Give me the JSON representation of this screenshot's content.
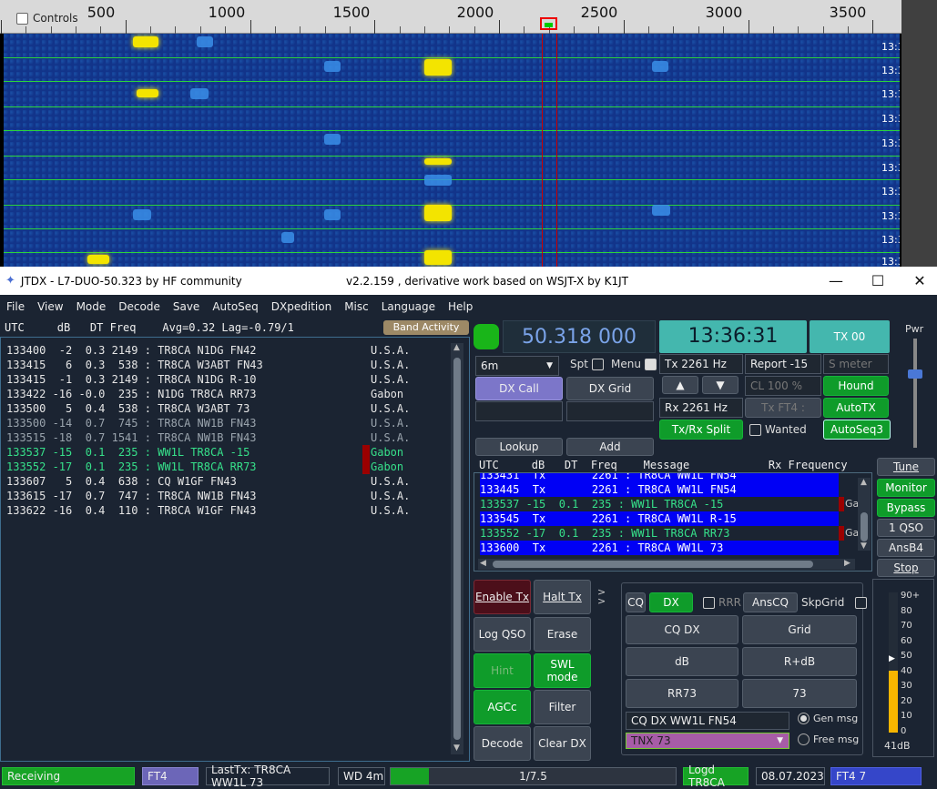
{
  "waterfall": {
    "controls_label": "Controls",
    "scale_labels": [
      "500",
      "1000",
      "1500",
      "2000",
      "2500",
      "3000",
      "3500"
    ],
    "row_time": "13:36"
  },
  "window": {
    "title": "JTDX - L7-DUO-50.323  by HF community",
    "version": "v2.2.159 , derivative work based on WSJT-X by K1JT",
    "minimize": "—",
    "maximize": "☐",
    "close": "✕"
  },
  "menu": [
    "File",
    "View",
    "Mode",
    "Decode",
    "Save",
    "AutoSeq",
    "DXpedition",
    "Misc",
    "Language",
    "Help"
  ],
  "band_activity": {
    "header": "UTC     dB   DT Freq    Avg=0.32 Lag=-0.79/1",
    "button": "Band Activity",
    "rows": [
      {
        "text": "133400  -2  0.3 2149 : TR8CA N1DG FN42",
        "country": "U.S.A.",
        "style": "w",
        "mark": false
      },
      {
        "text": "133415   6  0.3  538 : TR8CA W3ABT FN43",
        "country": "U.S.A.",
        "style": "w",
        "mark": false
      },
      {
        "text": "133415  -1  0.3 2149 : TR8CA N1DG R-10",
        "country": "U.S.A.",
        "style": "w",
        "mark": false
      },
      {
        "text": "133422 -16 -0.0  235 : N1DG TR8CA RR73",
        "country": "Gabon",
        "style": "w",
        "mark": false
      },
      {
        "text": "133500   5  0.4  538 : TR8CA W3ABT 73",
        "country": "U.S.A.",
        "style": "w",
        "mark": false
      },
      {
        "text": "133500 -14  0.7  745 : TR8CA NW1B FN43",
        "country": "U.S.A.",
        "style": "g",
        "mark": false
      },
      {
        "text": "133515 -18  0.7 1541 : TR8CA NW1B FN43",
        "country": "U.S.A.",
        "style": "g",
        "mark": false
      },
      {
        "text": "133537 -15  0.1  235 : WW1L TR8CA -15",
        "country": "Gabon",
        "style": "gr",
        "mark": true
      },
      {
        "text": "133552 -17  0.1  235 : WW1L TR8CA RR73",
        "country": "Gabon",
        "style": "gr",
        "mark": true
      },
      {
        "text": "133607   5  0.4  638 : CQ W1GF FN43",
        "country": "U.S.A.",
        "style": "w",
        "mark": false
      },
      {
        "text": "133615 -17  0.7  747 : TR8CA NW1B FN43",
        "country": "U.S.A.",
        "style": "w",
        "mark": false
      },
      {
        "text": "133622 -16  0.4  110 : TR8CA W1GF FN43",
        "country": "U.S.A.",
        "style": "w",
        "mark": false
      }
    ]
  },
  "controls": {
    "frequency": "50.318 000",
    "clock": "13:36:31",
    "tx00": "TX 00",
    "pwr": "Pwr",
    "band": "6m",
    "spt": "Spt",
    "menu_cb": "Menu",
    "dx_call": "DX Call",
    "dx_grid": "DX Grid",
    "tx_freq": "Tx  2261  Hz",
    "rx_freq": "Rx  2261  Hz",
    "report": "Report -15",
    "s_meter_placeholder": "S meter",
    "cl": "CL  100 %",
    "tx_ft4": "Tx FT4 :",
    "hound": "Hound",
    "autotx": "AutoTX",
    "txrx_split": "Tx/Rx Split",
    "wanted": "Wanted",
    "autoseq3": "AutoSeq3",
    "lookup": "Lookup",
    "add": "Add",
    "up_arrow": "▲",
    "down_arrow": "▼"
  },
  "rx_freq": {
    "header": "UTC     dB   DT  Freq    Message            Rx Frequency",
    "rows": [
      {
        "text": "133431  Tx       2261 : TR8CA WW1L FN54",
        "style": "tx",
        "country": ""
      },
      {
        "text": "133445  Tx       2261 : TR8CA WW1L FN54",
        "style": "tx",
        "country": ""
      },
      {
        "text": "133537 -15  0.1  235 : WW1L TR8CA -15",
        "style": "gr",
        "country": "Ga"
      },
      {
        "text": "133545  Tx       2261 : TR8CA WW1L R-15",
        "style": "tx",
        "country": ""
      },
      {
        "text": "133552 -17  0.1  235 : WW1L TR8CA RR73",
        "style": "gr",
        "country": "Ga"
      },
      {
        "text": "133600  Tx       2261 : TR8CA WW1L 73",
        "style": "tx",
        "country": ""
      }
    ]
  },
  "side_buttons": [
    "Tune",
    "Monitor",
    "Bypass",
    "1 QSO",
    "AnsB4",
    "Stop"
  ],
  "tx_buttons": {
    "enable_tx": "Enable Tx",
    "halt_tx": "Halt Tx",
    "log_qso": "Log QSO",
    "erase": "Erase",
    "hint": "Hint",
    "swl_mode": "SWL mode",
    "agcc": "AGCc",
    "filter": "Filter",
    "decode": "Decode",
    "clear_dx": "Clear DX"
  },
  "messages": {
    "cq": "CQ",
    "dx": "DX",
    "rrr": "RRR",
    "anscq": "AnsCQ",
    "skpgrid": "SkpGrid",
    "cq_dx": "CQ DX",
    "grid": "Grid",
    "db": "dB",
    "r_db": "R+dB",
    "rr73": "RR73",
    "seventy_three": "73",
    "gen_msg_text": "CQ DX WW1L FN54",
    "gen_msg": "Gen msg",
    "free_msg_text": "TNX 73",
    "free_msg": "Free msg"
  },
  "meter": {
    "ticks": [
      "90+",
      "80",
      "70",
      "60",
      "50",
      "40",
      "30",
      "20",
      "10",
      "0"
    ],
    "level_db": "41dB",
    "level_value": 41
  },
  "statusbar": {
    "state": "Receiving",
    "mode": "FT4",
    "last_tx": "LastTx: TR8CA WW1L 73",
    "wd": "WD 4m",
    "progress_text": "1/7.5",
    "progress_fraction": 0.133,
    "logd": "Logd TR8CA",
    "date": "08.07.2023",
    "mode_slot": "FT4  7"
  },
  "colors": {
    "green": "#17a325",
    "teal": "#44b7ae",
    "tx_blue": "#0000f5",
    "decode_green": "#36e08a"
  }
}
